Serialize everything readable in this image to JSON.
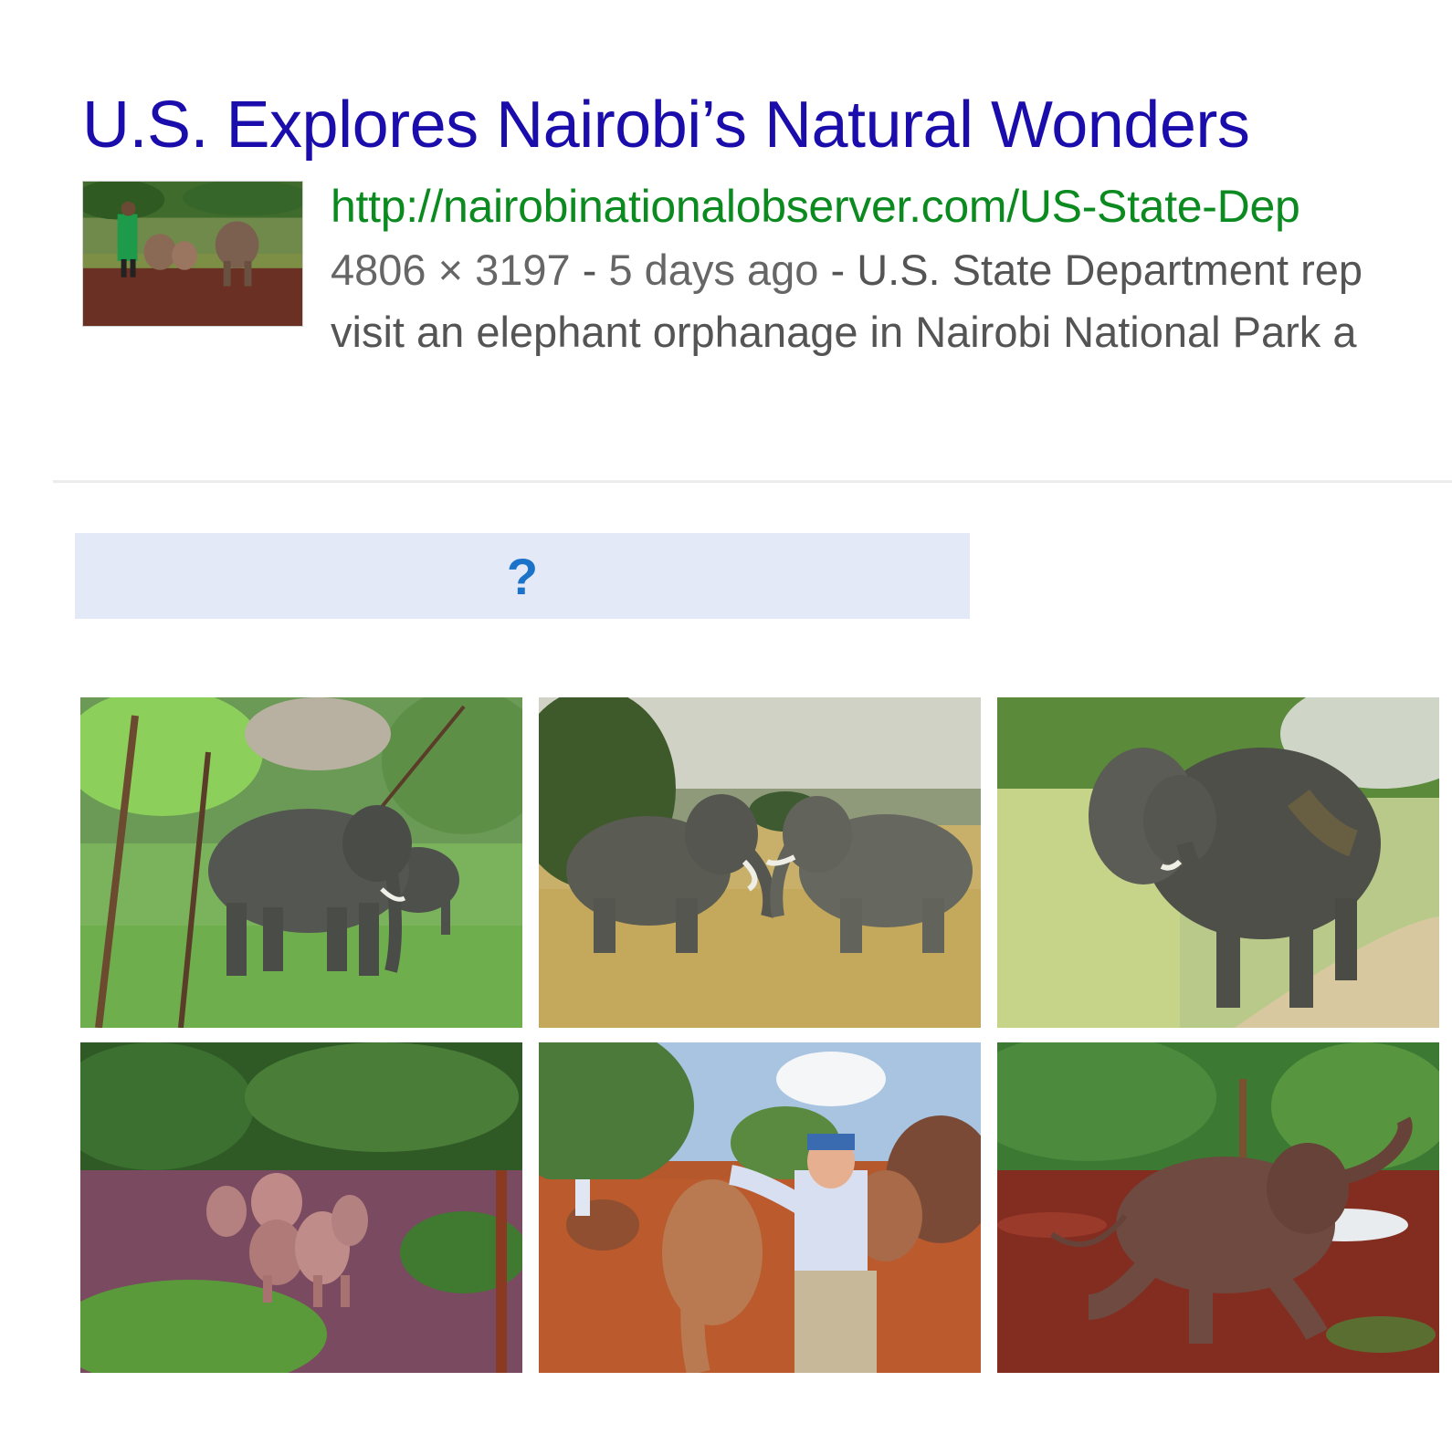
{
  "result": {
    "title": "U.S. Explores Nairobi’s Natural Wonders",
    "url": "http://nairobinationalobserver.com/US-State-Dep",
    "meta_dimensions": "4806 × 3197",
    "meta_separator": " - ",
    "meta_age": "5 days ago",
    "meta_separator_2": " - ",
    "meta_description": "U.S. State Department rep",
    "snippet": "visit an elephant orphanage in Nairobi National Park a",
    "thumbnail_icon": "elephant-keeper-photo"
  },
  "more_button": {
    "label": "?"
  },
  "image_grid": {
    "images": [
      {
        "icon": "elephants-in-forest-photo"
      },
      {
        "icon": "elephants-sparring-photo"
      },
      {
        "icon": "elephant-grass-roadside-photo"
      },
      {
        "icon": "baby-elephant-herd-photo"
      },
      {
        "icon": "man-with-baby-elephant-photo"
      },
      {
        "icon": "baby-elephant-walking-photo"
      }
    ]
  }
}
